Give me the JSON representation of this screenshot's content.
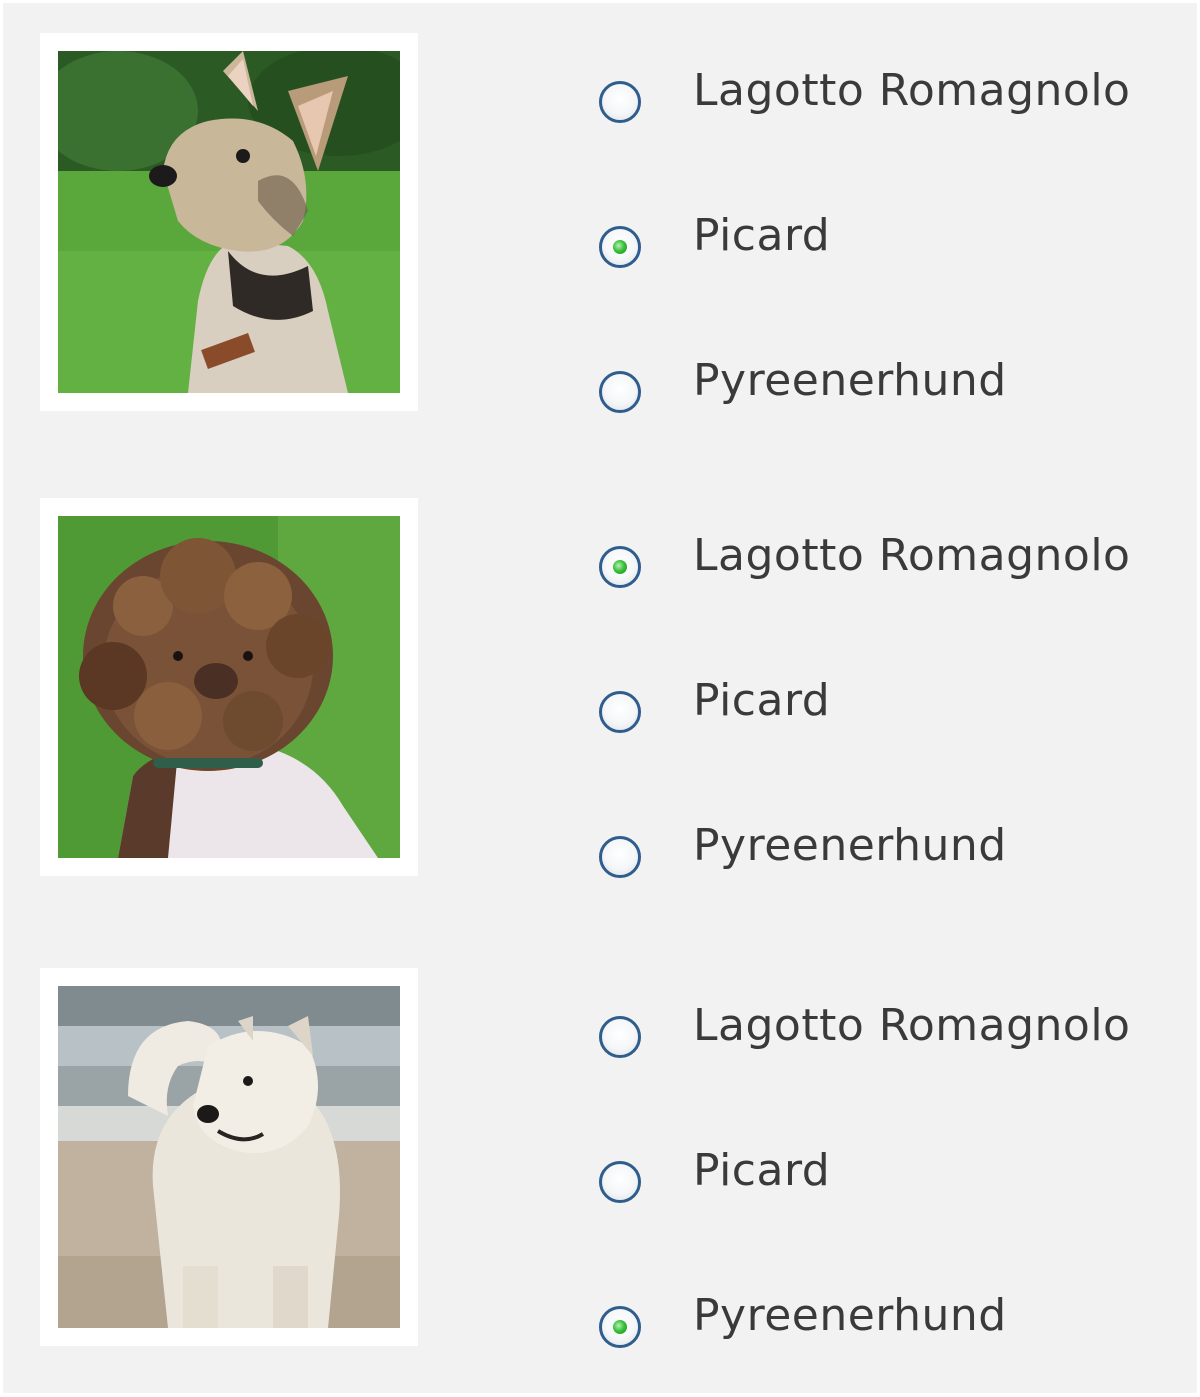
{
  "questions": [
    {
      "image_alt": "Picard dog",
      "options": [
        {
          "label": "Lagotto Romagnolo",
          "checked": false
        },
        {
          "label": "Picard",
          "checked": true
        },
        {
          "label": "Pyreenerhund",
          "checked": false
        }
      ]
    },
    {
      "image_alt": "Lagotto Romagnolo dog",
      "options": [
        {
          "label": "Lagotto Romagnolo",
          "checked": true
        },
        {
          "label": "Picard",
          "checked": false
        },
        {
          "label": "Pyreenerhund",
          "checked": false
        }
      ]
    },
    {
      "image_alt": "Pyreenerhund dog",
      "options": [
        {
          "label": "Lagotto Romagnolo",
          "checked": false
        },
        {
          "label": "Picard",
          "checked": false
        },
        {
          "label": "Pyreenerhund",
          "checked": true
        }
      ]
    }
  ],
  "colors": {
    "panel_bg": "#f2f2f2",
    "radio_border": "#2f5d8c",
    "radio_dot": "#3cc23c",
    "label_text": "#3a3a3a"
  }
}
